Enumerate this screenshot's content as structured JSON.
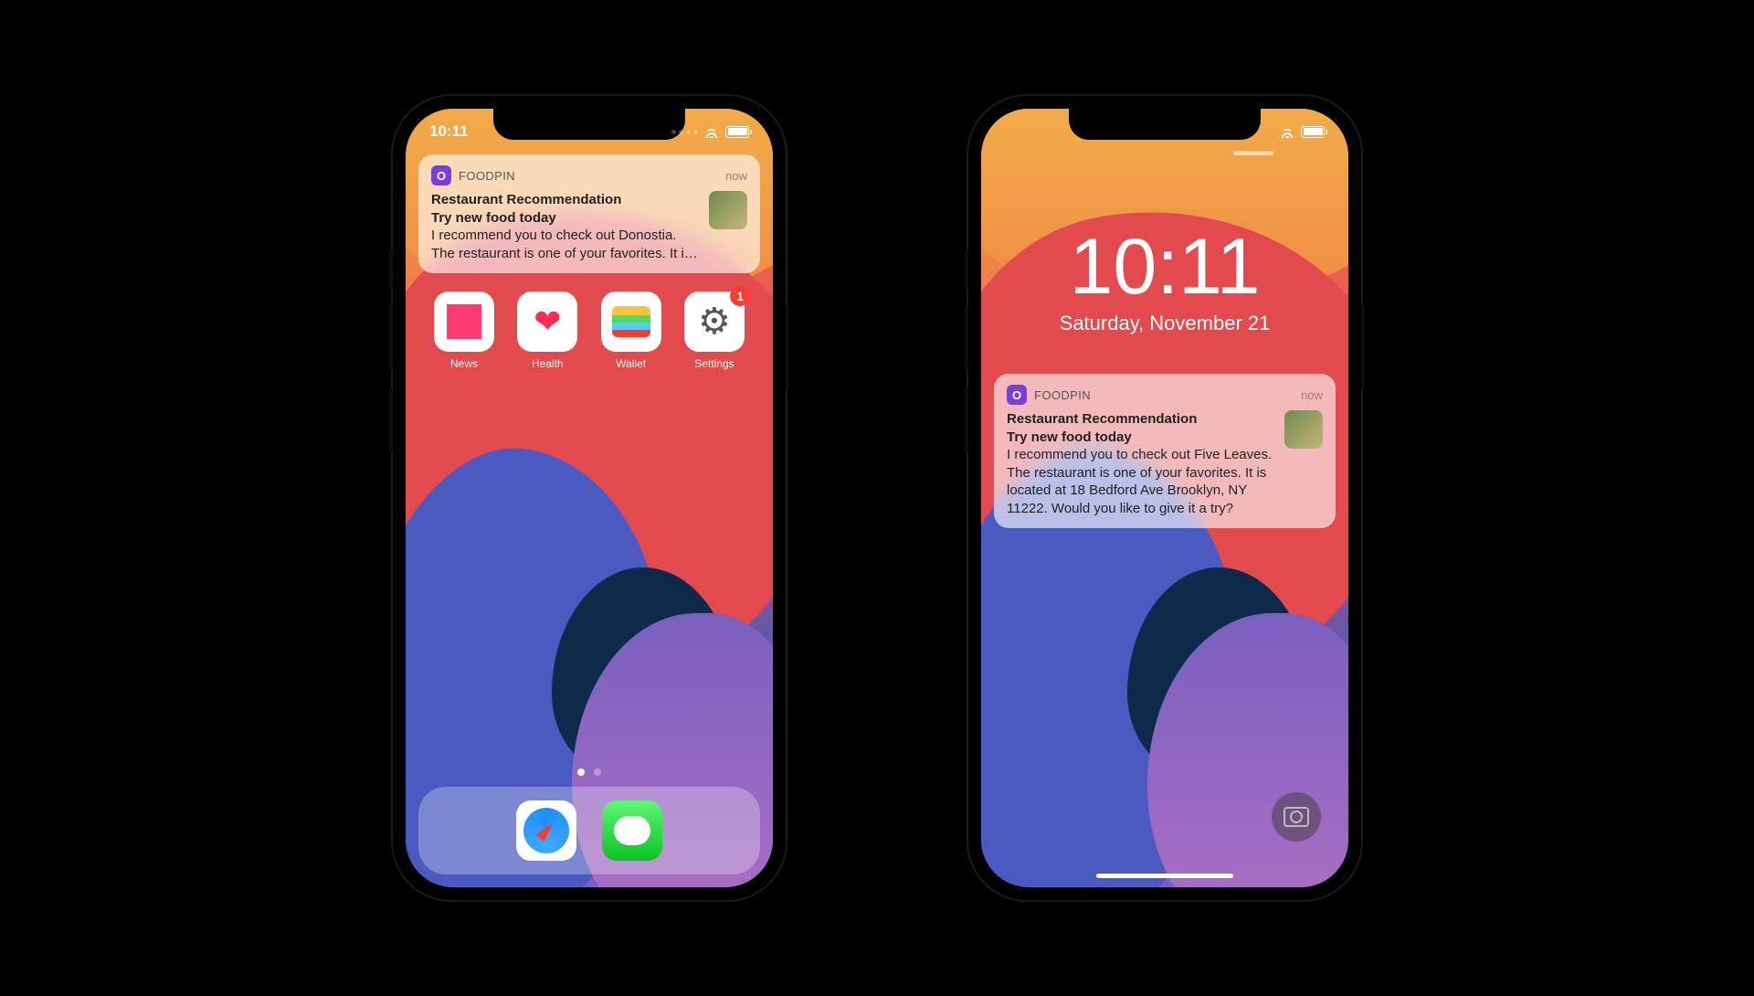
{
  "left": {
    "status": {
      "time": "10:11"
    },
    "notification": {
      "app_icon_letter": "O",
      "app_name": "FOODPIN",
      "timestamp": "now",
      "title": "Restaurant Recommendation",
      "subtitle": "Try new food today",
      "body": "I recommend you to check out Donostia. The restaurant is one of your favorites. It i…"
    },
    "apps": [
      {
        "name": "News"
      },
      {
        "name": "Health"
      },
      {
        "name": "Wallet"
      },
      {
        "name": "Settings",
        "badge": "1"
      }
    ],
    "dock": [
      {
        "name": "Safari"
      },
      {
        "name": "Messages"
      }
    ]
  },
  "right": {
    "lock": {
      "time": "10:11",
      "date": "Saturday, November 21"
    },
    "notification": {
      "app_icon_letter": "O",
      "app_name": "FOODPIN",
      "timestamp": "now",
      "title": "Restaurant Recommendation",
      "subtitle": "Try new food today",
      "body": "I recommend you to check out Five Leaves. The restaurant is one of your favorites. It is located at 18 Bedford Ave Brooklyn, NY 11222. Would you like to give it a try?"
    }
  }
}
